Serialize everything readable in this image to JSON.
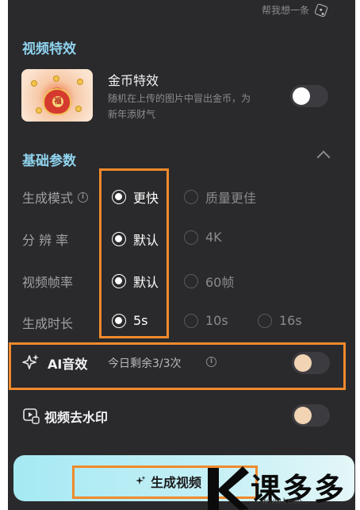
{
  "top_hint": {
    "text": "帮我想一条"
  },
  "video_effects": {
    "title": "视频特效",
    "coin_effect": {
      "title": "金币特效",
      "description": "随机在上传的图片中冒出金币，为新年添财气",
      "thumb_char": "福",
      "enabled": false
    }
  },
  "basic_params": {
    "title": "基础参数",
    "rows": [
      {
        "label": "生成模式",
        "options": [
          "更快",
          "质量更佳"
        ],
        "selected": "更快"
      },
      {
        "label": "分 辨 率",
        "options": [
          "默认",
          "4K"
        ],
        "selected": "默认"
      },
      {
        "label": "视频帧率",
        "options": [
          "默认",
          "60帧"
        ],
        "selected": "默认"
      },
      {
        "label": "生成时长",
        "options": [
          "5s",
          "10s",
          "16s"
        ],
        "selected": "5s"
      }
    ]
  },
  "ai_sound": {
    "label": "AI音效",
    "remaining": "今日剩余3/3次",
    "enabled": false
  },
  "remove_watermark": {
    "label": "视频去水印",
    "enabled": false
  },
  "generate_button": {
    "label": "生成视频"
  },
  "watermark": {
    "chars": "课多多",
    "url": "www.kedo..."
  },
  "colors": {
    "panel_bg": "#2a2a2c",
    "section_title": "#8fd3ee",
    "highlight_box": "#f08a2c",
    "button_gradient_start": "#a5e9f3"
  }
}
